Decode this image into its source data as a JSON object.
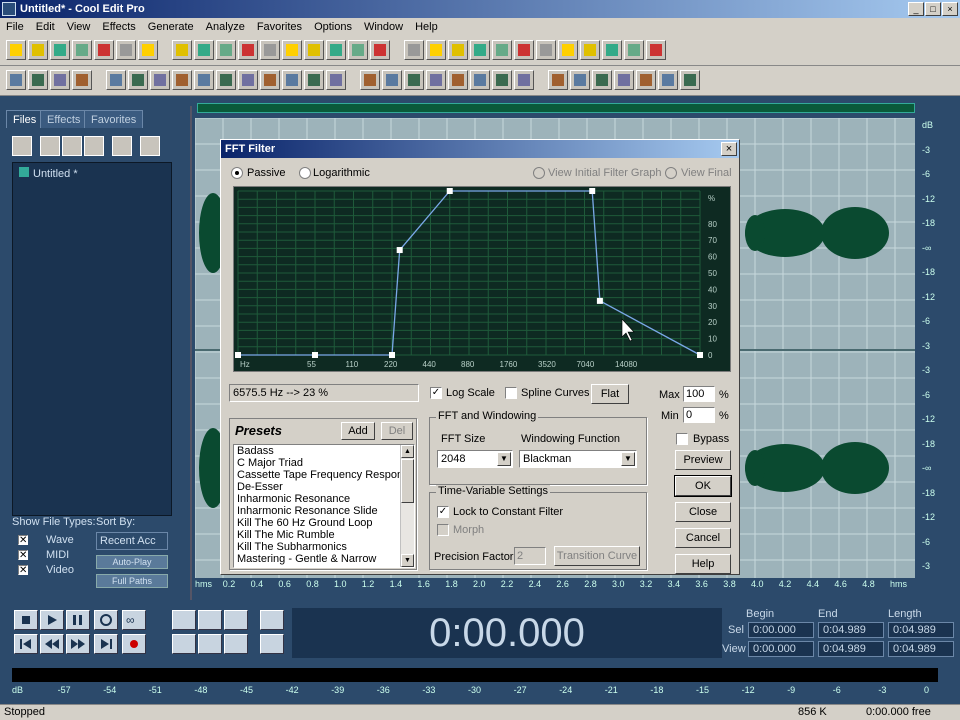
{
  "window": {
    "title": "Untitled* - Cool Edit Pro"
  },
  "menu": [
    "File",
    "Edit",
    "View",
    "Effects",
    "Generate",
    "Analyze",
    "Favorites",
    "Options",
    "Window",
    "Help"
  ],
  "left_panel": {
    "tabs": [
      "Files",
      "Effects",
      "Favorites"
    ],
    "files": [
      "Untitled *"
    ],
    "show_file_types_label": "Show File Types:",
    "sort_by_label": "Sort By:",
    "types": [
      "Wave",
      "MIDI",
      "Video"
    ],
    "sort_value": "Recent Acc",
    "auto_play": "Auto-Play",
    "full_paths": "Full Paths"
  },
  "waveform": {
    "db_labels": [
      "dB",
      "-3",
      "-6",
      "-12",
      "-18",
      "-∞",
      "-18",
      "-12",
      "-6",
      "-3",
      "-3",
      "-6",
      "-12",
      "-18",
      "-∞",
      "-18",
      "-12",
      "-6",
      "-3"
    ],
    "ruler_labels": [
      "hms",
      "0.2",
      "0.4",
      "0.6",
      "0.8",
      "1.0",
      "1.2",
      "1.4",
      "1.6",
      "1.8",
      "2.0",
      "2.2",
      "2.4",
      "2.6",
      "2.8",
      "3.0",
      "3.2",
      "3.4",
      "3.6",
      "3.8",
      "4.0",
      "4.2",
      "4.4",
      "4.6",
      "4.8",
      "hms"
    ]
  },
  "transport": {
    "time": "0:00.000",
    "headers": [
      "Begin",
      "End",
      "Length"
    ],
    "sel_label": "Sel",
    "view_label": "View",
    "sel": [
      "0:00.000",
      "0:04.989",
      "0:04.989"
    ],
    "view": [
      "0:00.000",
      "0:04.989",
      "0:04.989"
    ]
  },
  "meter_scale": [
    "dB",
    "-57",
    "-54",
    "-51",
    "-48",
    "-45",
    "-42",
    "-39",
    "-36",
    "-33",
    "-30",
    "-27",
    "-24",
    "-21",
    "-18",
    "-15",
    "-12",
    "-9",
    "-6",
    "-3",
    "0"
  ],
  "status": {
    "state": "Stopped",
    "memory": "856 K",
    "free": "0:00.000 free"
  },
  "dialog": {
    "title": "FFT Filter",
    "close": "×",
    "passive": "Passive",
    "logarithmic": "Logarithmic",
    "view_initial": "View Initial Filter Graph",
    "view_final": "View Final",
    "graph": {
      "y_labels": [
        "%",
        "80",
        "70",
        "60",
        "50",
        "40",
        "30",
        "20",
        "10",
        "0"
      ],
      "x_labels": [
        "Hz",
        "55",
        "110",
        "220",
        "440",
        "880",
        "1760",
        "3520",
        "7040",
        "14080"
      ],
      "points": [
        [
          0,
          0
        ],
        [
          2,
          0
        ],
        [
          4,
          0
        ],
        [
          4.2,
          64
        ],
        [
          5.5,
          100
        ],
        [
          9.2,
          100
        ],
        [
          9.4,
          33
        ],
        [
          12,
          0
        ]
      ],
      "point_axis": "x in octave steps from 27.5 Hz, y in %"
    },
    "readout": "6575.5 Hz --> 23 %",
    "log_scale": "Log Scale",
    "spline_curves": "Spline Curves",
    "flat": "Flat",
    "max_label": "Max",
    "max_value": "100",
    "min_label": "Min",
    "min_value": "0",
    "pct": "%",
    "presets_title": "Presets",
    "add": "Add",
    "del": "Del",
    "presets": [
      "Badass",
      "C Major Triad",
      "Cassette Tape Frequency Response",
      "De-Esser",
      "Inharmonic Resonance",
      "Inharmonic Resonance Slide",
      "Kill The 60 Hz  Ground Loop",
      "Kill The Mic Rumble",
      "Kill The Subharmonics",
      "Mastering - Gentle & Narrow"
    ],
    "fft_group": "FFT and Windowing",
    "fft_size_label": "FFT Size",
    "fft_size": "2048",
    "window_label": "Windowing Function",
    "window_value": "Blackman",
    "tv_group": "Time-Variable Settings",
    "lock": "Lock to Constant Filter",
    "morph": "Morph",
    "precision_label": "Precision Factor",
    "precision_value": "2",
    "transition": "Transition Curve",
    "bypass": "Bypass",
    "preview": "Preview",
    "ok": "OK",
    "close_btn": "Close",
    "cancel": "Cancel",
    "help": "Help"
  }
}
